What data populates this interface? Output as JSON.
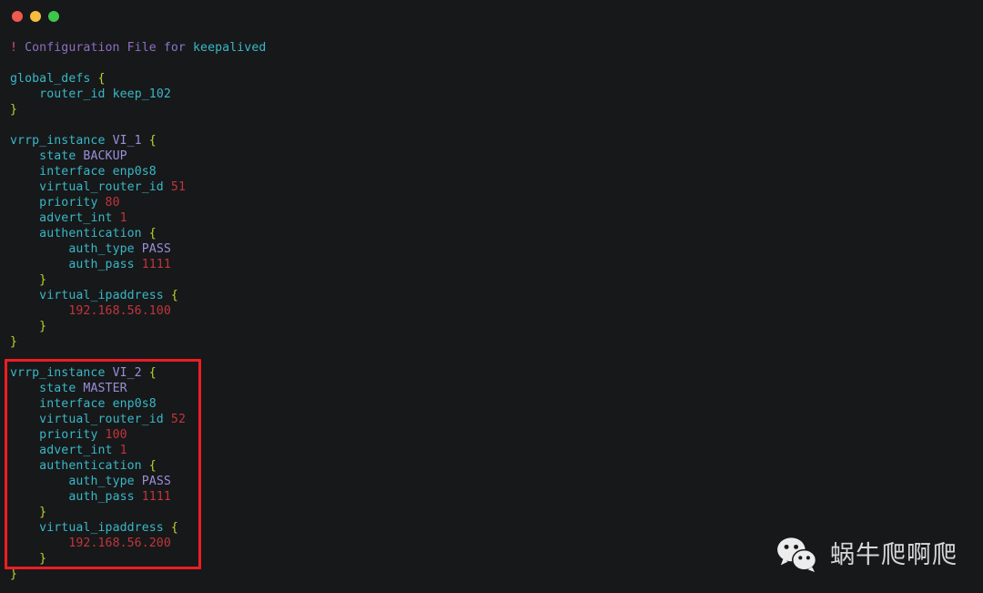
{
  "window": {
    "title": "",
    "controls": [
      {
        "name": "close",
        "color": "#f0594f"
      },
      {
        "name": "minimize",
        "color": "#f6bc3e"
      },
      {
        "name": "maximize",
        "color": "#3ec74b"
      }
    ],
    "background": "#17181a"
  },
  "editor": {
    "language": "keepalived-conf",
    "colors": {
      "comment_bang": "#e0507a",
      "comment_text": "#8e6fc4",
      "key": "#38b8c6",
      "string_value": "#9b8ed8",
      "number": "#c0363c",
      "brace": "#c0d22c"
    },
    "lines": [
      {
        "n": 1,
        "type": "comment",
        "bang": "!",
        "text": " Configuration File",
        "text2": " for ",
        "text3": "keepalived"
      },
      {
        "n": 2,
        "type": "blank",
        "text": ""
      },
      {
        "n": 3,
        "type": "block_open",
        "key": "global_defs",
        "brace": "{"
      },
      {
        "n": 4,
        "type": "kv",
        "indent": 1,
        "key": "router_id",
        "value": "keep_102",
        "value_kind": "cyan"
      },
      {
        "n": 5,
        "type": "close",
        "indent": 0,
        "brace": "}"
      },
      {
        "n": 6,
        "type": "blank",
        "text": ""
      },
      {
        "n": 7,
        "type": "block_open",
        "key": "vrrp_instance",
        "name": "VI_1",
        "brace": "{"
      },
      {
        "n": 8,
        "type": "kv",
        "indent": 1,
        "key": "state",
        "value": "BACKUP",
        "value_kind": "str"
      },
      {
        "n": 9,
        "type": "kv",
        "indent": 1,
        "key": "interface",
        "value": "enp0s8",
        "value_kind": "cyan"
      },
      {
        "n": 10,
        "type": "kv",
        "indent": 1,
        "key": "virtual_router_id",
        "value": "51",
        "value_kind": "num"
      },
      {
        "n": 11,
        "type": "kv",
        "indent": 1,
        "key": "priority",
        "value": "80",
        "value_kind": "num"
      },
      {
        "n": 12,
        "type": "kv",
        "indent": 1,
        "key": "advert_int",
        "value": "1",
        "value_kind": "num"
      },
      {
        "n": 13,
        "type": "block_open",
        "indent": 1,
        "key": "authentication",
        "brace": "{"
      },
      {
        "n": 14,
        "type": "kv",
        "indent": 2,
        "key": "auth_type",
        "value": "PASS",
        "value_kind": "str"
      },
      {
        "n": 15,
        "type": "kv",
        "indent": 2,
        "key": "auth_pass",
        "value": "1111",
        "value_kind": "num"
      },
      {
        "n": 16,
        "type": "close",
        "indent": 1,
        "brace": "}"
      },
      {
        "n": 17,
        "type": "block_open",
        "indent": 1,
        "key": "virtual_ipaddress",
        "brace": "{"
      },
      {
        "n": 18,
        "type": "value",
        "indent": 2,
        "value": "192.168.56.100",
        "value_kind": "num"
      },
      {
        "n": 19,
        "type": "close",
        "indent": 1,
        "brace": "}"
      },
      {
        "n": 20,
        "type": "close",
        "indent": 0,
        "brace": "}"
      },
      {
        "n": 21,
        "type": "blank",
        "text": ""
      },
      {
        "n": 22,
        "type": "block_open",
        "key": "vrrp_instance",
        "name": "VI_2",
        "brace": "{",
        "highlighted": true
      },
      {
        "n": 23,
        "type": "kv",
        "indent": 1,
        "key": "state",
        "value": "MASTER",
        "value_kind": "str",
        "highlighted": true
      },
      {
        "n": 24,
        "type": "kv",
        "indent": 1,
        "key": "interface",
        "value": "enp0s8",
        "value_kind": "cyan",
        "highlighted": true
      },
      {
        "n": 25,
        "type": "kv",
        "indent": 1,
        "key": "virtual_router_id",
        "value": "52",
        "value_kind": "num",
        "highlighted": true
      },
      {
        "n": 26,
        "type": "kv",
        "indent": 1,
        "key": "priority",
        "value": "100",
        "value_kind": "num",
        "highlighted": true
      },
      {
        "n": 27,
        "type": "kv",
        "indent": 1,
        "key": "advert_int",
        "value": "1",
        "value_kind": "num",
        "highlighted": true
      },
      {
        "n": 28,
        "type": "block_open",
        "indent": 1,
        "key": "authentication",
        "brace": "{",
        "highlighted": true
      },
      {
        "n": 29,
        "type": "kv",
        "indent": 2,
        "key": "auth_type",
        "value": "PASS",
        "value_kind": "str",
        "highlighted": true
      },
      {
        "n": 30,
        "type": "kv",
        "indent": 2,
        "key": "auth_pass",
        "value": "1111",
        "value_kind": "num",
        "highlighted": true
      },
      {
        "n": 31,
        "type": "close",
        "indent": 1,
        "brace": "}",
        "highlighted": true
      },
      {
        "n": 32,
        "type": "block_open",
        "indent": 1,
        "key": "virtual_ipaddress",
        "brace": "{",
        "highlighted": true
      },
      {
        "n": 33,
        "type": "value",
        "indent": 2,
        "value": "192.168.56.200",
        "value_kind": "num",
        "highlighted": true
      },
      {
        "n": 34,
        "type": "close",
        "indent": 1,
        "brace": "}",
        "highlighted": true
      },
      {
        "n": 35,
        "type": "close",
        "indent": 0,
        "brace": "}"
      }
    ]
  },
  "annotation": {
    "color": "#ee1d24",
    "label": "vrrp_instance VI_2 block highlight"
  },
  "watermark": {
    "text": "蜗牛爬啊爬",
    "icon": "wechat-icon",
    "color": "#e8e8e8"
  }
}
